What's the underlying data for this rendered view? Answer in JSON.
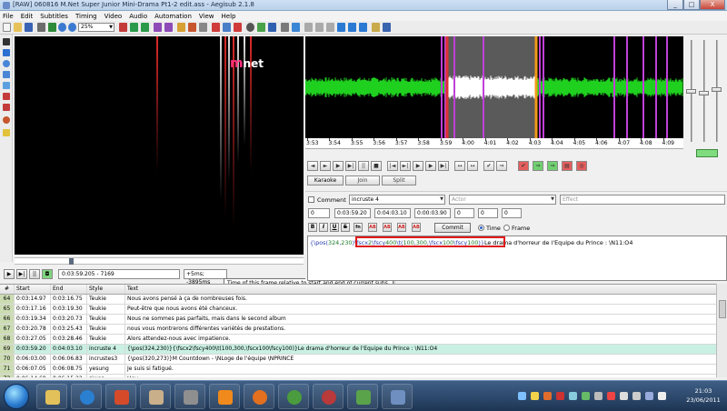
{
  "window": {
    "title": "[RAW] 060816 M.Net Super Junior Mini-Drama Pt1-2 edit.ass - Aegisub 2.1.8",
    "minimize": "_",
    "maximize": "□",
    "close": "X"
  },
  "menu": [
    "File",
    "Edit",
    "Subtitles",
    "Timing",
    "Video",
    "Audio",
    "Automation",
    "View",
    "Help"
  ],
  "toolbar": {
    "zoom": "25%"
  },
  "video": {
    "logo_m": "m",
    "logo_text": "net"
  },
  "video_controls": {
    "time": "0:03:59.205 - 7169",
    "offset": "+5ms; -3895ms",
    "tooltip": "Time of this frame relative to start and end of current subs."
  },
  "audio": {
    "timeline_labels": [
      "3:53",
      "3:54",
      "3:55",
      "3:56",
      "3:57",
      "3:58",
      "3:59",
      "4:00",
      "4:01",
      "4:02",
      "4:03",
      "4:04",
      "4:05",
      "4:06",
      "4:07",
      "4:08",
      "4:09"
    ]
  },
  "karaoke": {
    "karaoke": "Karaoke",
    "join": "Join",
    "split": "Split"
  },
  "edit": {
    "comment_label": "Comment",
    "style": "incruste 4",
    "actor_placeholder": "Actor",
    "effect_placeholder": "Effect",
    "layer": "0",
    "start": "0:03:59.20",
    "end": "0:04:03.10",
    "duration": "0:00:03.90",
    "margin_l": "0",
    "margin_r": "0",
    "margin_v": "0",
    "bold": "B",
    "italic": "I",
    "underline": "U",
    "strike": "S",
    "font": "fn",
    "color1": "AB",
    "color2": "AB",
    "color3": "AB",
    "color4": "AB",
    "commit": "Commit",
    "time_label": "Time",
    "frame_label": "Frame",
    "text_parts": [
      {
        "t": "{\\pos(",
        "c": "tag"
      },
      {
        "t": "324",
        "c": "num"
      },
      {
        "t": ",",
        "c": "tag"
      },
      {
        "t": "230",
        "c": "num"
      },
      {
        "t": ")",
        "c": "tag"
      },
      {
        "t": "\\fscx",
        "c": "tag"
      },
      {
        "t": "2",
        "c": "num"
      },
      {
        "t": "\\fscy",
        "c": "tag"
      },
      {
        "t": "400",
        "c": "num"
      },
      {
        "t": "\\t(",
        "c": "tag"
      },
      {
        "t": "100",
        "c": "num"
      },
      {
        "t": ",",
        "c": "tag"
      },
      {
        "t": "300",
        "c": "num"
      },
      {
        "t": ",\\fscx",
        "c": "tag"
      },
      {
        "t": "100",
        "c": "num"
      },
      {
        "t": "\\fscy",
        "c": "tag"
      },
      {
        "t": "100",
        "c": "num"
      },
      {
        "t": ")}",
        "c": "tag"
      },
      {
        "t": "Le drama d'horreur de l'Equipe du Prince : \\N11:O4",
        "c": "plain"
      }
    ]
  },
  "grid": {
    "headers": [
      "#",
      "Start",
      "End",
      "Style",
      "Text"
    ],
    "rows": [
      {
        "n": "64",
        "start": "0:03:14.97",
        "end": "0:03:16.75",
        "style": "Teukie",
        "text": "Nous avons pensé à ça de nombreuses fois."
      },
      {
        "n": "65",
        "start": "0:03:17.16",
        "end": "0:03:19.30",
        "style": "Teukie",
        "text": "Peut-être que nous avons été chanceux."
      },
      {
        "n": "66",
        "start": "0:03:19.34",
        "end": "0:03:20.73",
        "style": "Teukie",
        "text": "Nous ne sommes pas parfaits, mais dans le second album"
      },
      {
        "n": "67",
        "start": "0:03:20.78",
        "end": "0:03:25.43",
        "style": "Teukie",
        "text": "nous vous montrerons différentes variétés de prestations."
      },
      {
        "n": "68",
        "start": "0:03:27.05",
        "end": "0:03:28.46",
        "style": "Teukie",
        "text": "Alors attendez-nous avec impatience."
      },
      {
        "n": "69",
        "start": "0:03:59.20",
        "end": "0:04:03.10",
        "style": "incruste 4",
        "text": "{\\pos(324,230)}{\\fscx2\\fscy400\\t(100,300,\\fscx100\\fscy100)}Le drama d'horreur de l'Equipe du Prince : \\N11:O4"
      },
      {
        "n": "70",
        "start": "0:06:03.00",
        "end": "0:06:06.83",
        "style": "incrustes3",
        "text": "{\\pos(320,273)}M Countdown - \\NLoge de l'équipe \\NPRINCE"
      },
      {
        "n": "71",
        "start": "0:06:07.05",
        "end": "0:06:08.75",
        "style": "yesung",
        "text": "Je suis si fatigué."
      },
      {
        "n": "72",
        "start": "0:06:14.68",
        "end": "0:06:15.22",
        "style": "siwon",
        "text": "Hey."
      }
    ],
    "active_index": 5
  },
  "taskbar": {
    "time": "21:03",
    "date": "23/06/2011"
  },
  "colors": {
    "waveform": "#1fd01f",
    "waveform_selected": "#ffffff",
    "selection": "#5a5a5a",
    "marker": "#c040d8",
    "active_row": "#c9f0e3",
    "highlight_box": "#e01a1a"
  }
}
